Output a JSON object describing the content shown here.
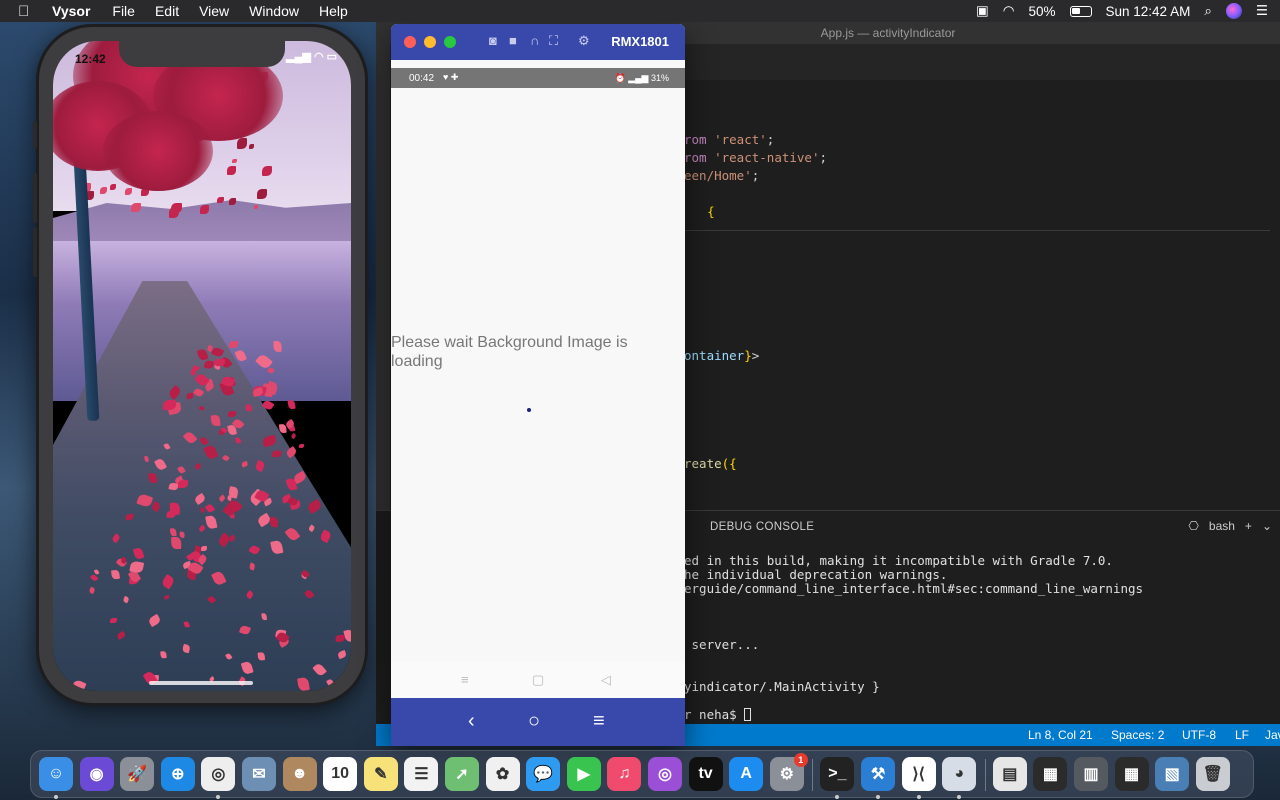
{
  "menubar": {
    "app_name": "Vysor",
    "menus": [
      "File",
      "Edit",
      "View",
      "Window",
      "Help"
    ],
    "battery_percent": "50%",
    "battery_level": 0.5,
    "clock": "Sun 12:42 AM"
  },
  "vscode": {
    "window_title": "App.js — activityIndicator",
    "code_lines": [
      {
        "parts": [
          [
            "kw",
            "rom "
          ],
          [
            "str",
            "'react'"
          ],
          [
            "plain",
            ";"
          ]
        ]
      },
      {
        "parts": [
          [
            "kw",
            "rom "
          ],
          [
            "str",
            "'react-native'"
          ],
          [
            "plain",
            ";"
          ]
        ]
      },
      {
        "parts": [
          [
            "str",
            "een/Home'"
          ],
          [
            "plain",
            ";"
          ]
        ]
      },
      {
        "parts": [
          [
            "plain",
            "  "
          ],
          [
            "br",
            "{"
          ]
        ]
      },
      {
        "parts": [
          [
            "var",
            "ontainer"
          ],
          [
            "br",
            "}"
          ],
          [
            "plain",
            ">"
          ]
        ]
      },
      {
        "parts": [
          [
            "fn",
            "reate"
          ],
          [
            "br",
            "({"
          ]
        ]
      }
    ],
    "panel_tab": "DEBUG CONSOLE",
    "terminal_shell": "bash",
    "terminal_lines": [
      "ed in this build, making it incompatible with Gradle 7.0.",
      "he individual deprecation warnings.",
      "erguide/command_line_interface.html#sec:command_line_warnings",
      " server...",
      "yindicator/.MainActivity }",
      "r neha$ "
    ],
    "status": {
      "position": "Ln 8, Col 21",
      "spaces": "Spaces: 2",
      "encoding": "UTF-8",
      "eol": "LF",
      "language": "Jav"
    }
  },
  "iphone": {
    "time": "12:42"
  },
  "vysor": {
    "device_name": "RMX1801",
    "android_time": "00:42",
    "android_battery": "31%",
    "message": "Please wait Background Image is loading"
  },
  "dock": {
    "items": [
      {
        "name": "finder-icon",
        "color": "#3a8ee6",
        "glyph": "☺",
        "running": true
      },
      {
        "name": "siri-icon",
        "color": "#6b4bd6",
        "glyph": "◉",
        "running": false
      },
      {
        "name": "launchpad-icon",
        "color": "#8a8f98",
        "glyph": "🚀",
        "running": false
      },
      {
        "name": "safari-icon",
        "color": "#1e88e5",
        "glyph": "⊕",
        "running": false
      },
      {
        "name": "chrome-icon",
        "color": "#eeeeee",
        "glyph": "◎",
        "running": true
      },
      {
        "name": "mail-icon",
        "color": "#6d8fb3",
        "glyph": "✉",
        "running": false
      },
      {
        "name": "contacts-icon",
        "color": "#b08860",
        "glyph": "☻",
        "running": false
      },
      {
        "name": "calendar-icon",
        "color": "#ffffff",
        "glyph": "10",
        "running": false
      },
      {
        "name": "notes-icon",
        "color": "#f7e27a",
        "glyph": "✎",
        "running": false
      },
      {
        "name": "reminders-icon",
        "color": "#f2f2f2",
        "glyph": "☰",
        "running": false
      },
      {
        "name": "maps-icon",
        "color": "#6fbf73",
        "glyph": "➚",
        "running": false
      },
      {
        "name": "photos-icon",
        "color": "#f0f0f0",
        "glyph": "✿",
        "running": false
      },
      {
        "name": "messages-icon",
        "color": "#2e9bf0",
        "glyph": "💬",
        "running": false
      },
      {
        "name": "facetime-icon",
        "color": "#39c34f",
        "glyph": "▶",
        "running": false
      },
      {
        "name": "music-icon",
        "color": "#f04a6c",
        "glyph": "♫",
        "running": false
      },
      {
        "name": "podcasts-icon",
        "color": "#9a4fd6",
        "glyph": "◎",
        "running": false
      },
      {
        "name": "appletv-icon",
        "color": "#111111",
        "glyph": "tv",
        "running": false
      },
      {
        "name": "appstore-icon",
        "color": "#1d8cf0",
        "glyph": "A",
        "running": false
      },
      {
        "name": "system-preferences-icon",
        "color": "#8a8f98",
        "glyph": "⚙",
        "running": false,
        "badge": "1"
      },
      {
        "name": "terminal-icon",
        "color": "#222222",
        "glyph": ">_",
        "running": true
      },
      {
        "name": "xcode-icon",
        "color": "#2a7fd4",
        "glyph": "⚒",
        "running": true
      },
      {
        "name": "vscode-icon",
        "color": "#ffffff",
        "glyph": "⟩⟨",
        "running": true
      },
      {
        "name": "vysor-icon",
        "color": "#d6dde6",
        "glyph": "◕",
        "running": true
      },
      {
        "name": "document-stack-icon",
        "color": "#e6e6e6",
        "glyph": "▤",
        "running": false
      },
      {
        "name": "recent-window-1-icon",
        "color": "#2b2b2b",
        "glyph": "▦",
        "running": false
      },
      {
        "name": "recent-window-2-icon",
        "color": "#555a60",
        "glyph": "▥",
        "running": false
      },
      {
        "name": "recent-window-3-icon",
        "color": "#2b2b2b",
        "glyph": "▦",
        "running": false
      },
      {
        "name": "recent-window-4-icon",
        "color": "#4a7fb5",
        "glyph": "▧",
        "running": false
      },
      {
        "name": "trash-icon",
        "color": "#c9ccd0",
        "glyph": "🗑",
        "running": false
      }
    ]
  }
}
